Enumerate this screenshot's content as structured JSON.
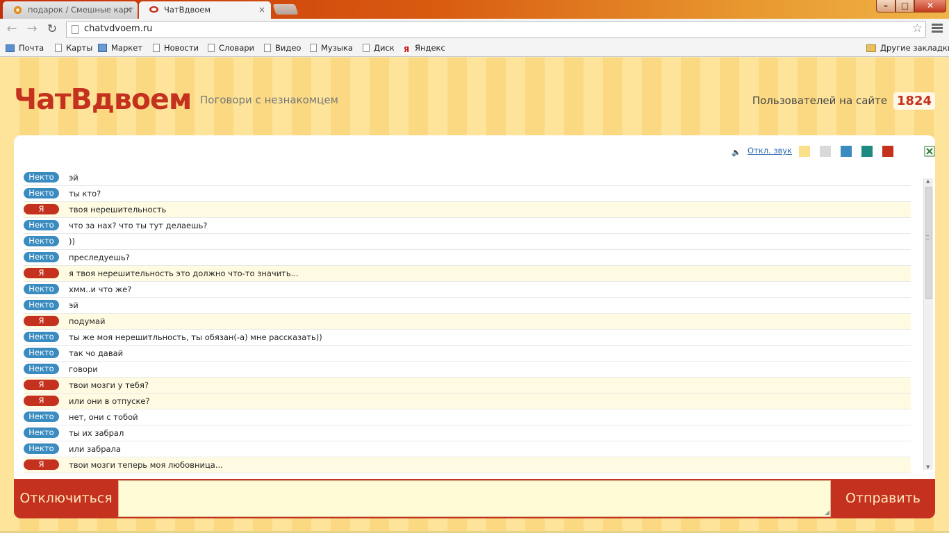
{
  "browser": {
    "tabs": [
      {
        "title": "подарок / Смешные карт",
        "active": false
      },
      {
        "title": "ЧатВдвоем",
        "active": true
      }
    ],
    "address": "chatvdvoem.ru",
    "bookmarks": [
      "Почта",
      "Карты",
      "Маркет",
      "Новости",
      "Словари",
      "Видео",
      "Музыка",
      "Диск",
      "Яндекс"
    ],
    "other_bookmarks": "Другие закладки"
  },
  "header": {
    "logo": "ЧатВдвоем",
    "tagline": "Поговори с незнакомцем",
    "users_label": "Пользователей на сайте",
    "users_count": "1824"
  },
  "controls": {
    "mute_label": "Откл. звук",
    "theme_colors": [
      "#fbe08a",
      "#d9d9d9",
      "#3a8cc0",
      "#1f8a80",
      "#c4311e"
    ]
  },
  "labels": {
    "stranger": "Некто",
    "me": "Я"
  },
  "messages": [
    {
      "from": "stranger",
      "text": "эй"
    },
    {
      "from": "stranger",
      "text": "ты кто?"
    },
    {
      "from": "me",
      "text": "твоя нерешительность"
    },
    {
      "from": "stranger",
      "text": "что за нах? что ты тут делаешь?"
    },
    {
      "from": "stranger",
      "text": "))"
    },
    {
      "from": "stranger",
      "text": "преследуешь?"
    },
    {
      "from": "me",
      "text": "я твоя нерешительность это должно что-то значить..."
    },
    {
      "from": "stranger",
      "text": "хмм..и что же?"
    },
    {
      "from": "stranger",
      "text": "эй"
    },
    {
      "from": "me",
      "text": "подумай"
    },
    {
      "from": "stranger",
      "text": "ты же моя нерешитльность, ты обязан(-а) мне рассказать))"
    },
    {
      "from": "stranger",
      "text": "так чо давай"
    },
    {
      "from": "stranger",
      "text": "говори"
    },
    {
      "from": "me",
      "text": "твои мозги у тебя?"
    },
    {
      "from": "me",
      "text": "или они в отпуске?"
    },
    {
      "from": "stranger",
      "text": "нет, они с тобой"
    },
    {
      "from": "stranger",
      "text": "ты их забрал"
    },
    {
      "from": "stranger",
      "text": "или забрала"
    },
    {
      "from": "me",
      "text": "твои мозги теперь моя любовница..."
    }
  ],
  "actions": {
    "disconnect": "Отключиться",
    "send": "Отправить",
    "message_value": ""
  }
}
